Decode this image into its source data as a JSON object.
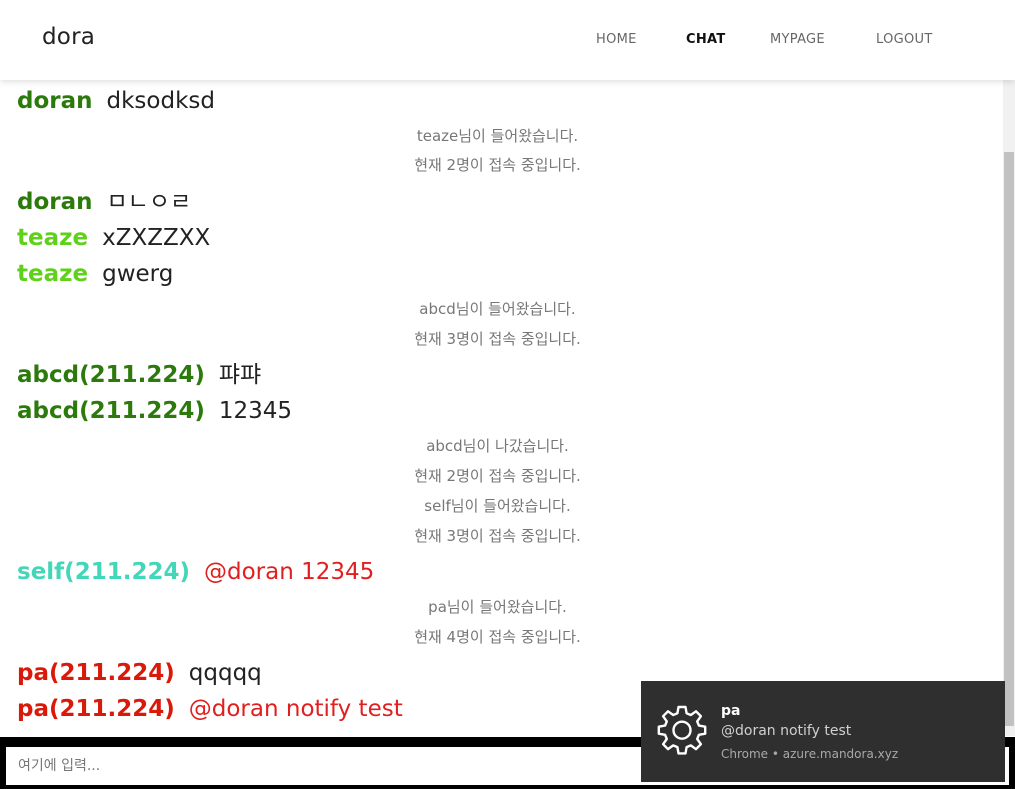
{
  "header": {
    "brand": "dora",
    "nav": [
      {
        "label": "HOME",
        "active": false
      },
      {
        "label": "CHAT",
        "active": true
      },
      {
        "label": "MYPAGE",
        "active": false
      },
      {
        "label": "LOGOUT",
        "active": false
      }
    ]
  },
  "chat": {
    "entries": [
      {
        "type": "message",
        "name": "doran",
        "text": "dksodksd",
        "name_color": "#2b7a0b",
        "text_color": "#222222"
      },
      {
        "type": "system",
        "text": "teaze님이 들어왔습니다."
      },
      {
        "type": "system",
        "text": "현재 2명이 접속 중입니다."
      },
      {
        "type": "message",
        "name": "doran",
        "text": "ㅁㄴㅇㄹ",
        "name_color": "#2b7a0b",
        "text_color": "#222222"
      },
      {
        "type": "message",
        "name": "teaze",
        "text": "xZXZZXX",
        "name_color": "#5fd11a",
        "text_color": "#222222"
      },
      {
        "type": "message",
        "name": "teaze",
        "text": "gwerg",
        "name_color": "#5fd11a",
        "text_color": "#222222"
      },
      {
        "type": "system",
        "text": "abcd님이 들어왔습니다."
      },
      {
        "type": "system",
        "text": "현재 3명이 접속 중입니다."
      },
      {
        "type": "message",
        "name": "abcd(211.224)",
        "text": "퍄퍄",
        "name_color": "#2b7a0b",
        "text_color": "#222222"
      },
      {
        "type": "message",
        "name": "abcd(211.224)",
        "text": "12345",
        "name_color": "#2b7a0b",
        "text_color": "#222222"
      },
      {
        "type": "system",
        "text": "abcd님이 나갔습니다."
      },
      {
        "type": "system",
        "text": "현재 2명이 접속 중입니다."
      },
      {
        "type": "system",
        "text": "self님이 들어왔습니다."
      },
      {
        "type": "system",
        "text": "현재 3명이 접속 중입니다."
      },
      {
        "type": "message",
        "name": "self(211.224)",
        "text": "@doran 12345",
        "name_color": "#44d6b8",
        "text_color": "#e02020"
      },
      {
        "type": "system",
        "text": "pa님이 들어왔습니다."
      },
      {
        "type": "system",
        "text": "현재 4명이 접속 중입니다."
      },
      {
        "type": "message",
        "name": "pa(211.224)",
        "text": "qqqqq",
        "name_color": "#d91a0a",
        "text_color": "#222222"
      },
      {
        "type": "message",
        "name": "pa(211.224)",
        "text": "@doran notify test",
        "name_color": "#d91a0a",
        "text_color": "#e02020"
      }
    ]
  },
  "input": {
    "placeholder": "여기에 입력...",
    "value": ""
  },
  "notification": {
    "icon": "gear-icon",
    "title": "pa",
    "body": "@doran notify test",
    "source": "Chrome • azure.mandora.xyz"
  }
}
